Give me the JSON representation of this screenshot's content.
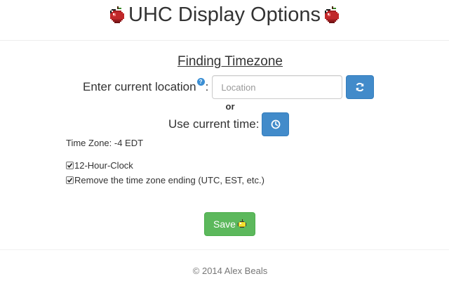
{
  "header": {
    "title": "UHC Display Options",
    "left_icon": "apple-icon",
    "right_icon": "apple-icon"
  },
  "timezone_section": {
    "title": "Finding Timezone",
    "location_label": "Enter current location",
    "location_help_icon": "help-icon",
    "location_colon": ":",
    "location_placeholder": "Location",
    "location_value": "",
    "refresh_icon": "refresh-icon",
    "or_text": "or",
    "current_time_label": "Use current time:",
    "clock_icon": "clock-icon",
    "timezone_text": "Time Zone: -4 EDT"
  },
  "options": [
    {
      "label": "12-Hour-Clock",
      "checked": true
    },
    {
      "label": "Remove the time zone ending (UTC, EST, etc.)",
      "checked": true
    }
  ],
  "save_button": {
    "label": "Save",
    "icon": "golden-apple-icon"
  },
  "footer": {
    "text": "© 2014 Alex Beals"
  },
  "colors": {
    "primary_button": "#428bca",
    "save_button": "#5cb85c",
    "help_icon": "#3b8fd4",
    "apple_red": "#c0282a"
  }
}
